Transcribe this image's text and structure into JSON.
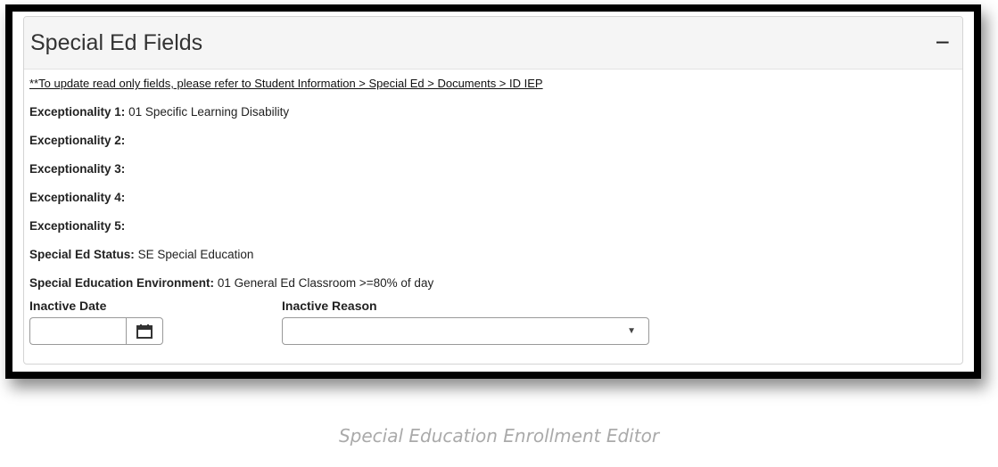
{
  "panel": {
    "title": "Special Ed Fields",
    "collapse_symbol": "−",
    "note": "**To update read only fields, please refer to Student Information > Special Ed > Documents > ID IEP"
  },
  "fields": [
    {
      "label": "Exceptionality 1:",
      "value": "01 Specific Learning Disability"
    },
    {
      "label": "Exceptionality 2:",
      "value": ""
    },
    {
      "label": "Exceptionality 3:",
      "value": ""
    },
    {
      "label": "Exceptionality 4:",
      "value": ""
    },
    {
      "label": "Exceptionality 5:",
      "value": ""
    },
    {
      "label": "Special Ed Status:",
      "value": "SE Special Education"
    },
    {
      "label": "Special Education Environment:",
      "value": "01 General Ed Classroom >=80% of day"
    }
  ],
  "inactive_date": {
    "label": "Inactive Date",
    "value": "",
    "icon": "calendar-icon"
  },
  "inactive_reason": {
    "label": "Inactive Reason",
    "selected": "",
    "icon": "chevron-down-icon"
  },
  "caption": "Special Education Enrollment Editor"
}
